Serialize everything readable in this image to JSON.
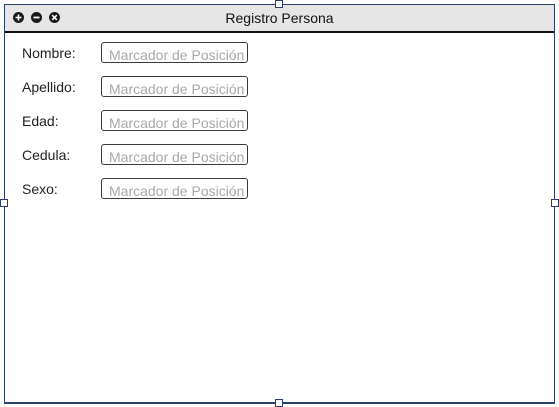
{
  "window": {
    "title": "Registro Persona",
    "buttons": [
      {
        "name": "maximize-icon"
      },
      {
        "name": "minimize-icon"
      },
      {
        "name": "close-icon"
      }
    ]
  },
  "form": {
    "fields": [
      {
        "label": "Nombre:",
        "placeholder": "Marcador de Posición",
        "value": ""
      },
      {
        "label": "Apellido:",
        "placeholder": "Marcador de Posición",
        "value": ""
      },
      {
        "label": "Edad:",
        "placeholder": "Marcador de Posición",
        "value": ""
      },
      {
        "label": "Cedula:",
        "placeholder": "Marcador de Posición",
        "value": ""
      },
      {
        "label": "Sexo:",
        "placeholder": "Marcador de Posición",
        "value": ""
      }
    ]
  },
  "colors": {
    "titlebar_bg": "#e6e6e6",
    "frame_border": "#2a3f6a",
    "placeholder_text": "#a8a8a8"
  }
}
